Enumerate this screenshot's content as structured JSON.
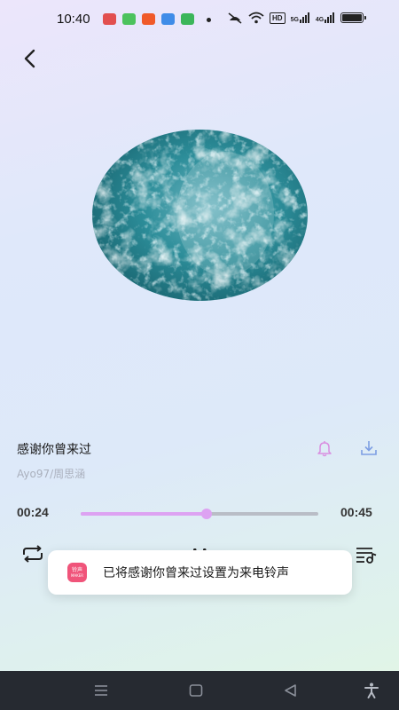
{
  "status_bar": {
    "time": "10:40",
    "hd_label": "HD",
    "signal_1_label": "5G",
    "signal_2_label": "4G",
    "notification_colors": [
      "#e24f4f",
      "#4cc25d",
      "#f05a2a",
      "#3f8ce8",
      "#3bb65a"
    ]
  },
  "header": {
    "back_icon": "chevron-left-icon"
  },
  "song": {
    "title": "感谢你曾来过",
    "artist": "Ayo97/周思涵"
  },
  "player": {
    "current_time": "00:24",
    "total_time": "00:45",
    "progress": 0.53,
    "accent_color": "#dda2f2"
  },
  "toast": {
    "app_icon_text": "铃声",
    "app_icon_subtext": "MAKER",
    "message": "已将感谢你曾来过设置为来电铃声"
  },
  "nav_bar": {
    "items": [
      "menu-icon",
      "home-icon",
      "back-icon",
      "accessibility-icon"
    ]
  }
}
